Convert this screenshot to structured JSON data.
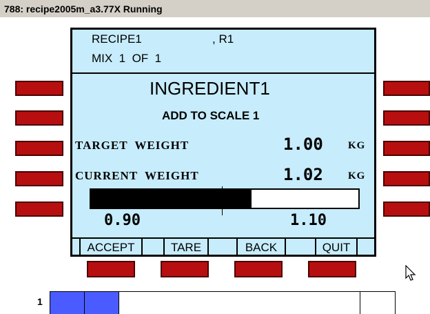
{
  "window": {
    "title": "788: recipe2005m_a3.77X Running"
  },
  "header": {
    "recipe": "RECIPE1",
    "recipe_suffix": ", R1",
    "mix": "MIX  1  OF  1"
  },
  "main": {
    "ingredient": "INGREDIENT1",
    "instruction": "ADD TO SCALE 1",
    "target_label": "TARGET  WEIGHT",
    "target_value": "1.00",
    "target_unit": "KG",
    "current_label": "CURRENT  WEIGHT",
    "current_value": "1.02",
    "current_unit": "KG",
    "range_min": "0.90",
    "range_max": "1.10",
    "progress_fraction": 0.6
  },
  "softkeys": {
    "accept": "ACCEPT",
    "tare": "TARE",
    "back": "BACK",
    "quit": "QUIT"
  },
  "taskbar": {
    "index": "1"
  },
  "colors": {
    "screen_bg": "#c7ecfb",
    "hw_button": "#b70f0f",
    "task_segment": "#4a5cff"
  }
}
